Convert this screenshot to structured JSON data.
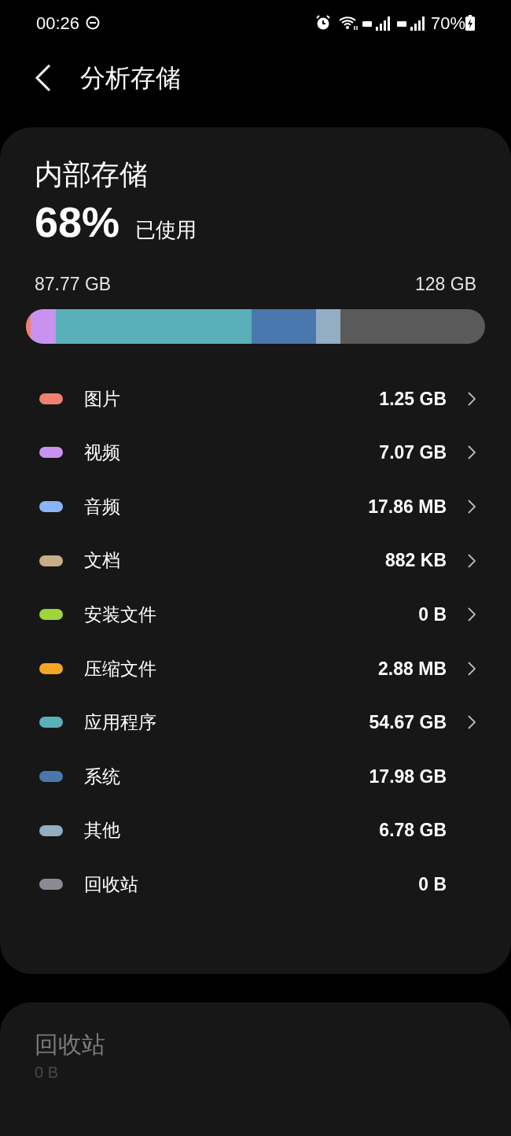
{
  "status_bar": {
    "time": "00:26",
    "battery": "70%"
  },
  "header": {
    "title": "分析存储"
  },
  "storage": {
    "title": "内部存储",
    "percent": "68%",
    "percent_label": "已使用",
    "used": "87.77 GB",
    "total": "128 GB",
    "categories": [
      {
        "name": "图片",
        "size": "1.25 GB",
        "color": "#f08070",
        "has_arrow": true
      },
      {
        "name": "视频",
        "size": "7.07 GB",
        "color": "#c792f0",
        "has_arrow": true
      },
      {
        "name": "音频",
        "size": "17.86 MB",
        "color": "#8ab4f8",
        "has_arrow": true
      },
      {
        "name": "文档",
        "size": "882 KB",
        "color": "#c8ae88",
        "has_arrow": true
      },
      {
        "name": "安装文件",
        "size": "0 B",
        "color": "#9ed43c",
        "has_arrow": true
      },
      {
        "name": "压缩文件",
        "size": "2.88 MB",
        "color": "#f5a623",
        "has_arrow": true
      },
      {
        "name": "应用程序",
        "size": "54.67 GB",
        "color": "#5ab0b8",
        "has_arrow": true
      },
      {
        "name": "系统",
        "size": "17.98 GB",
        "color": "#4a77ad",
        "has_arrow": false
      },
      {
        "name": "其他",
        "size": "6.78 GB",
        "color": "#93adc2",
        "has_arrow": false
      },
      {
        "name": "回收站",
        "size": "0 B",
        "color": "#8a8a92",
        "has_arrow": false
      }
    ]
  },
  "trash": {
    "title": "回收站",
    "size": "0 B",
    "disabled": true
  }
}
